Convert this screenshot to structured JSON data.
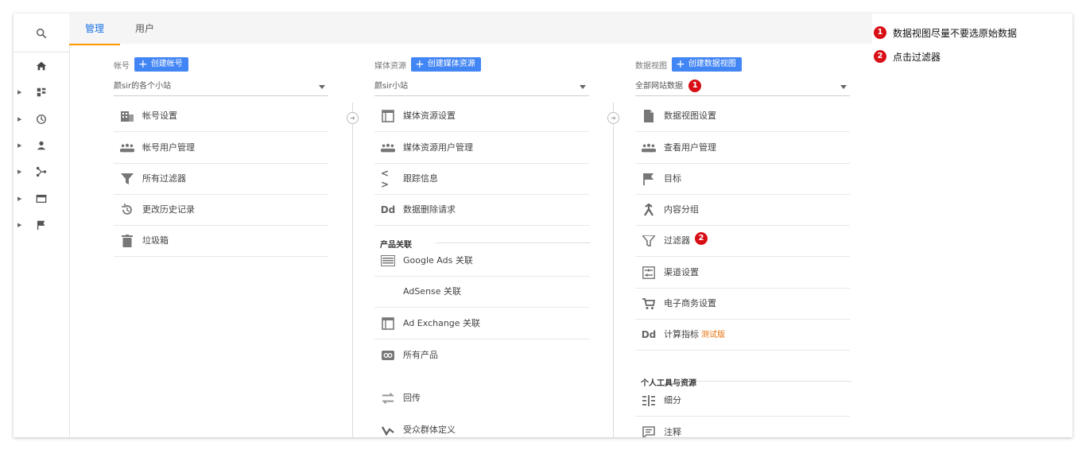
{
  "tabs": [
    {
      "label": "管理",
      "active": true
    },
    {
      "label": "用户",
      "active": false
    }
  ],
  "rail": {
    "items": [
      "search-icon",
      "home-icon",
      "dashboard-icon",
      "clock-icon",
      "person-icon",
      "share-icon",
      "card-icon",
      "flag-icon"
    ]
  },
  "account": {
    "header": "帐号",
    "create_label": "创建帐号",
    "selected": "颜sir的各个小站",
    "items": [
      {
        "label": "帐号设置",
        "icon": "building-icon"
      },
      {
        "label": "帐号用户管理",
        "icon": "users-icon"
      },
      {
        "label": "所有过滤器",
        "icon": "filter-icon"
      },
      {
        "label": "更改历史记录",
        "icon": "history-icon"
      },
      {
        "label": "垃圾箱",
        "icon": "trash-icon"
      }
    ]
  },
  "property": {
    "header": "媒体资源",
    "create_label": "创建媒体资源",
    "selected": "颜sir小站",
    "items": [
      {
        "label": "媒体资源设置",
        "icon": "window-icon"
      },
      {
        "label": "媒体资源用户管理",
        "icon": "users-icon"
      },
      {
        "label": "跟踪信息",
        "icon": "code-icon"
      },
      {
        "label": "数据删除请求",
        "icon": "dd-icon"
      }
    ],
    "product_section": "产品关联",
    "products": [
      {
        "label": "Google Ads 关联",
        "icon": "ads-icon"
      },
      {
        "label": "AdSense 关联",
        "icon": ""
      },
      {
        "label": "Ad Exchange 关联",
        "icon": "window-icon"
      },
      {
        "label": "所有产品",
        "icon": "link-icon"
      }
    ],
    "extra": [
      {
        "label": "回传",
        "icon": "postback-icon"
      },
      {
        "label": "受众群体定义",
        "icon": "audience-icon"
      }
    ]
  },
  "view": {
    "header": "数据视图",
    "create_label": "创建数据视图",
    "selected": "全部网站数据",
    "items": [
      {
        "label": "数据视图设置",
        "icon": "document-icon"
      },
      {
        "label": "查看用户管理",
        "icon": "users-icon"
      },
      {
        "label": "目标",
        "icon": "flag-icon"
      },
      {
        "label": "内容分组",
        "icon": "group-icon"
      },
      {
        "label": "过滤器",
        "icon": "filter-icon"
      },
      {
        "label": "渠道设置",
        "icon": "channel-icon"
      },
      {
        "label": "电子商务设置",
        "icon": "cart-icon"
      },
      {
        "label": "计算指标",
        "icon": "dd-icon",
        "beta": "测试版"
      }
    ],
    "tools_section": "个人工具与资源",
    "tools": [
      {
        "label": "细分",
        "icon": "segment-icon"
      },
      {
        "label": "注释",
        "icon": "comment-icon"
      }
    ]
  },
  "badges": {
    "one": "1",
    "two": "2"
  },
  "notes": [
    {
      "num": "1",
      "text": "数据视图尽量不要选原始数据"
    },
    {
      "num": "2",
      "text": "点击过滤器"
    }
  ],
  "colors": {
    "accent": "#1a73e8",
    "tab_underline": "#ff9800",
    "button": "#4285f4",
    "badge": "#d80e16",
    "beta": "#e8710a"
  }
}
